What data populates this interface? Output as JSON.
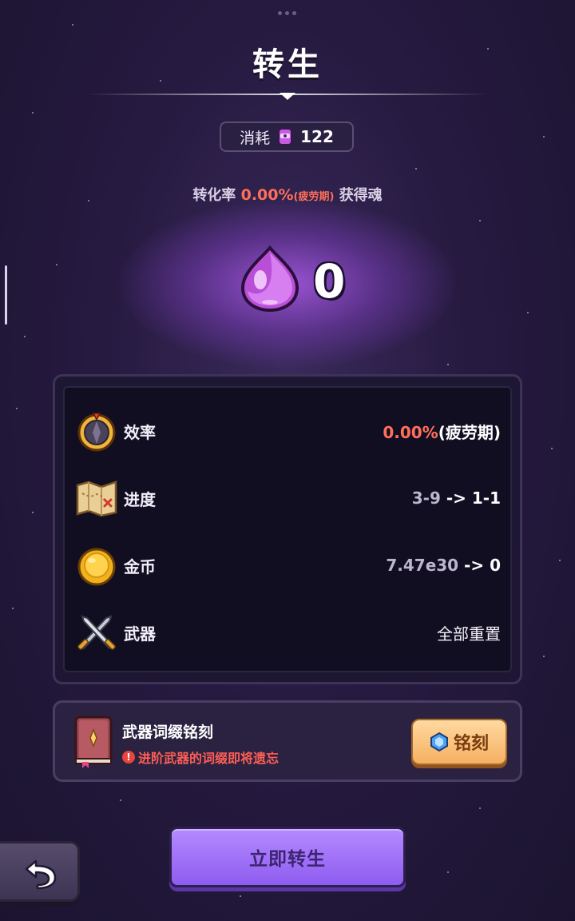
{
  "header": {
    "title": "转生"
  },
  "cost": {
    "label": "消耗",
    "value": "122",
    "icon": "soul-scroll-icon"
  },
  "conversion": {
    "prefix": "转化率",
    "rate": "0.00%",
    "tag": "(疲劳期)",
    "suffix": "获得魂"
  },
  "soul": {
    "count": "0",
    "icon": "purple-soul-drop-icon"
  },
  "stats": [
    {
      "icon": "compass-icon",
      "label": "效率",
      "value_highlight": "0.00%",
      "value_rest": "(疲劳期)"
    },
    {
      "icon": "treasure-map-icon",
      "label": "进度",
      "value_from": "3-9",
      "value_arrow": " -> ",
      "value_to": "1-1"
    },
    {
      "icon": "gold-coin-icon",
      "label": "金币",
      "value_from": "7.47e30",
      "value_arrow": " -> ",
      "value_to": "0"
    },
    {
      "icon": "crossed-swords-icon",
      "label": "武器",
      "value_plain": "全部重置"
    }
  ],
  "engrave": {
    "title": "武器词缀铭刻",
    "warning": "进阶武器的词缀即将遗忘",
    "button_label": "铭刻",
    "icon": "spell-book-icon"
  },
  "actions": {
    "rebirth_label": "立即转生",
    "back_icon": "undo-arrow-icon"
  },
  "colors": {
    "accent_red": "#ff6f5a",
    "purple_button": "#9b6cf5",
    "orange_button": "#f5b061"
  }
}
